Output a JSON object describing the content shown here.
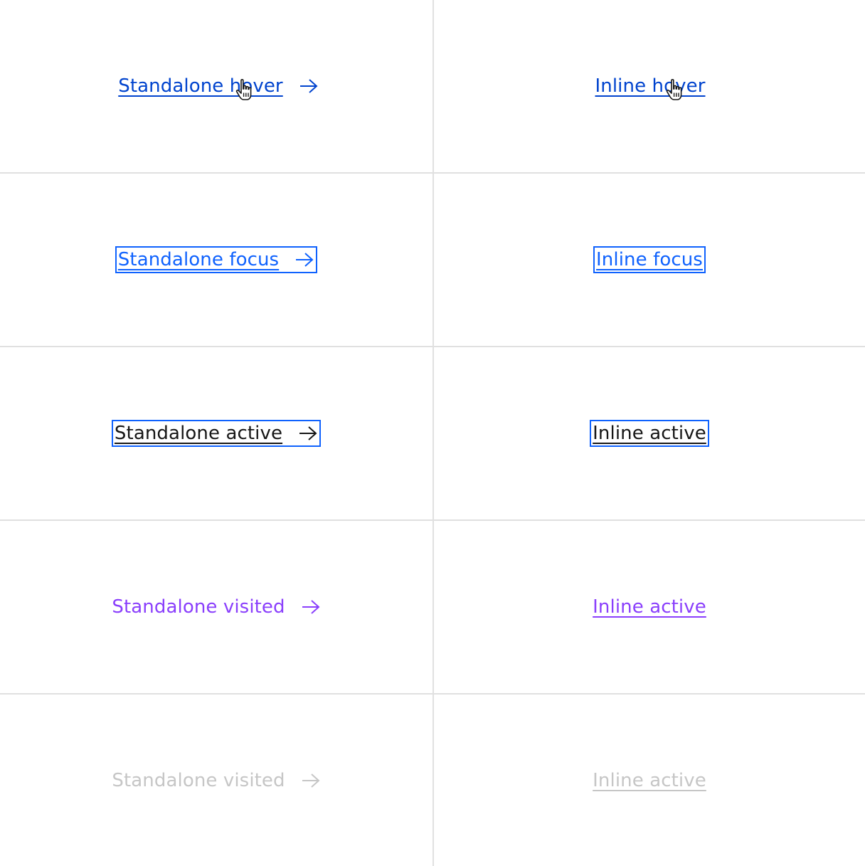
{
  "colors": {
    "link": "#0f62fe",
    "link_hover": "#0043ce",
    "active": "#161616",
    "visited": "#8a3ffc",
    "disabled": "#c6c6c6",
    "focus_outline": "#0f62fe",
    "grid_line": "#e0e0e0"
  },
  "rows": [
    {
      "standalone": "Standalone hover",
      "inline": "Inline hover",
      "state": "hover"
    },
    {
      "standalone": "Standalone focus",
      "inline": "Inline focus",
      "state": "focus"
    },
    {
      "standalone": "Standalone active",
      "inline": "Inline active",
      "state": "active"
    },
    {
      "standalone": "Standalone visited",
      "inline": "Inline active",
      "state": "visited"
    },
    {
      "standalone": "Standalone visited",
      "inline": "Inline active",
      "state": "disabled"
    }
  ],
  "icons": {
    "arrow": "arrow-right-icon",
    "cursor": "pointer-hand-cursor-icon"
  }
}
